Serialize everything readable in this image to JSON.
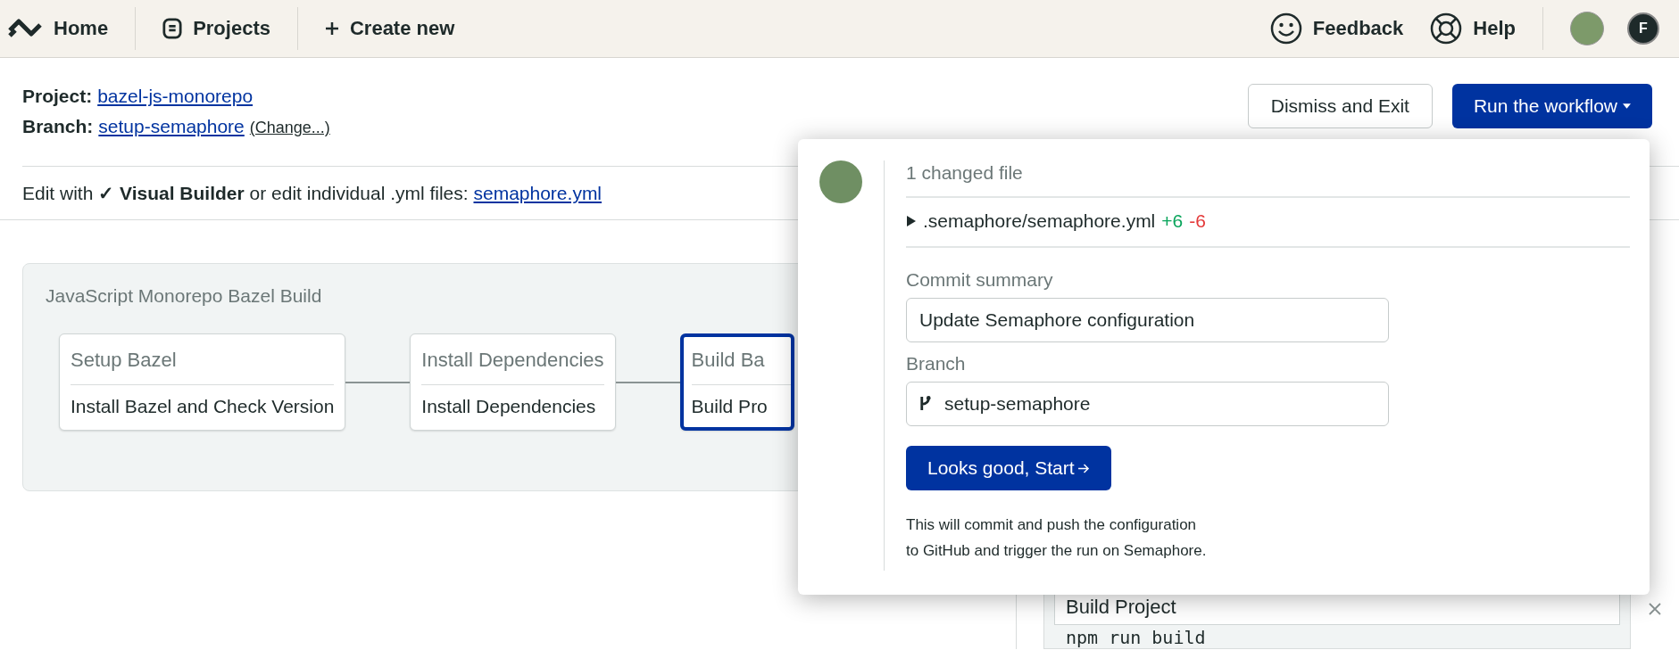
{
  "nav": {
    "left": [
      {
        "label": "Home"
      },
      {
        "label": "Projects"
      },
      {
        "label": "Create new"
      }
    ],
    "right": [
      {
        "label": "Feedback"
      },
      {
        "label": "Help"
      }
    ],
    "user_initial": "F"
  },
  "header": {
    "project_label": "Project:",
    "project": "bazel-js-monorepo",
    "branch_label": "Branch:",
    "branch": "setup-semaphore",
    "change_link": "(Change...)",
    "edit_text": "Edit with **✓ Visual Builder** or edit individual .yml files: ",
    "edit_link": "semaphore.yml"
  },
  "actions": {
    "dismiss": "Dismiss and Exit",
    "run": "Run the workflow"
  },
  "pipeline": {
    "title": "JavaScript Monorepo Bazel Build",
    "blocks": [
      {
        "title": "Setup Bazel",
        "job": "Install Bazel and Check Version",
        "selected": false
      },
      {
        "title": "Install Dependencies",
        "job": "Install Dependencies",
        "selected": false
      },
      {
        "title": "Build Ba",
        "job": "Build Pro",
        "selected": true
      }
    ]
  },
  "side_panel": {
    "job_name": "Build Project",
    "command": "npm run build"
  },
  "popup": {
    "changed": "1 changed file",
    "file": {
      "path": ".semaphore/semaphore.yml",
      "added": "+6",
      "removed": "-6",
      "expanded": false
    },
    "commit_label": "Commit summary",
    "commit_value": "Update Semaphore configuration",
    "branch_label": "Branch",
    "branch_value": "setup-semaphore",
    "start_button": "Looks good, Start",
    "note": "This will commit and push the configuration\nto GitHub and trigger the run on Semaphore."
  }
}
